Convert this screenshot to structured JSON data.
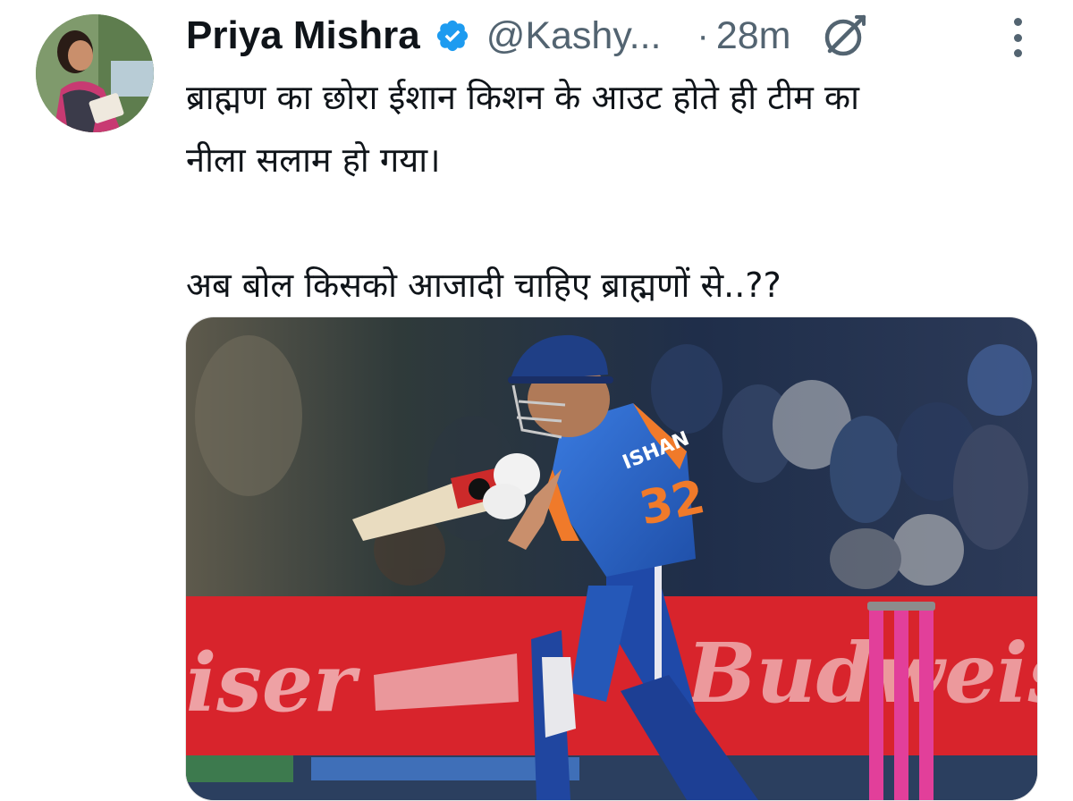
{
  "tweet": {
    "author_name": "Priya Mishra",
    "handle": "@Kashy...",
    "separator": "·",
    "time": "28m",
    "text_line_1": "ब्राह्मण का छोरा ईशान किशन के आउट होते ही टीम का",
    "text_line_2": "नीला सलाम हो गया।",
    "text_line_3": "अब बोल किसको आजादी चाहिए ब्राह्मणों से..??"
  },
  "icons": {
    "verified": "verified-badge-icon",
    "grok": "grok-icon",
    "more": "more-options-icon"
  },
  "media": {
    "jersey_name": "ISHAN",
    "jersey_number": "32",
    "banner_text_left": "iser",
    "banner_text_right": "Budweiser"
  },
  "colors": {
    "verified_blue": "#1d9bf0",
    "secondary_text": "#536471",
    "banner_red": "#d8242c",
    "stump_pink": "#e23f9a",
    "jersey_blue": "#2a62c6"
  }
}
